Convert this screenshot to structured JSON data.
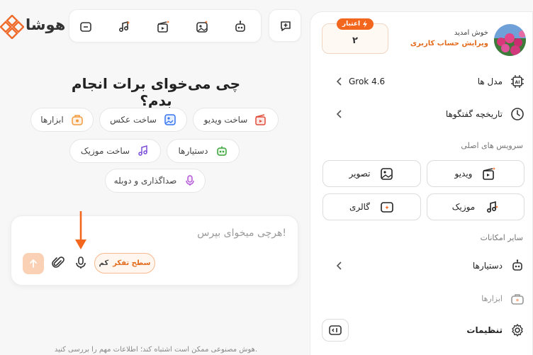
{
  "app": {
    "brand": "هوشا"
  },
  "toolbar": {
    "icons": [
      "folder-icon",
      "music-note-icon",
      "video-clapper-icon",
      "image-edit-icon",
      "robot-icon"
    ],
    "new_chat_icon": "chat-plus-icon"
  },
  "main": {
    "heading": "چی می‌خوای برات انجام بدم؟",
    "chips": {
      "video": "ساخت ویدیو",
      "image": "ساخت عکس",
      "tools": "ابزارها",
      "assistants": "دستیارها",
      "music": "ساخت موزیک",
      "dubbing": "صداگذاری و دوبله"
    },
    "input": {
      "placeholder": "هرچی میخوای بپرس!",
      "thinking_label": "سطح تفکر",
      "thinking_level": "کم"
    },
    "disclaimer": "هوش مصنوعی ممکن است اشتباه کند؛ اطلاعات مهم را بررسی کنید."
  },
  "sidebar": {
    "welcome": "خوش امدید",
    "edit_profile": "ویرایش حساب کاربری",
    "credit": {
      "label": "اعتبار",
      "value": "۲"
    },
    "model": {
      "label": "مدل ها",
      "value": "Grok 4.6"
    },
    "history": {
      "label": "تاریخچه گفتگوها"
    },
    "main_services_title": "سرویس های اصلی",
    "services": {
      "video": "ویدیو",
      "image": "تصویر",
      "music": "موزیک",
      "gallery": "گالری"
    },
    "other_title": "سایر امکانات",
    "assistants": "دستیارها",
    "tools": "ابزارها",
    "settings": "تنظیمات"
  },
  "colors": {
    "accent": "#f3661d",
    "accent_light": "#fbd1b6",
    "background": "#f7f7f8"
  }
}
